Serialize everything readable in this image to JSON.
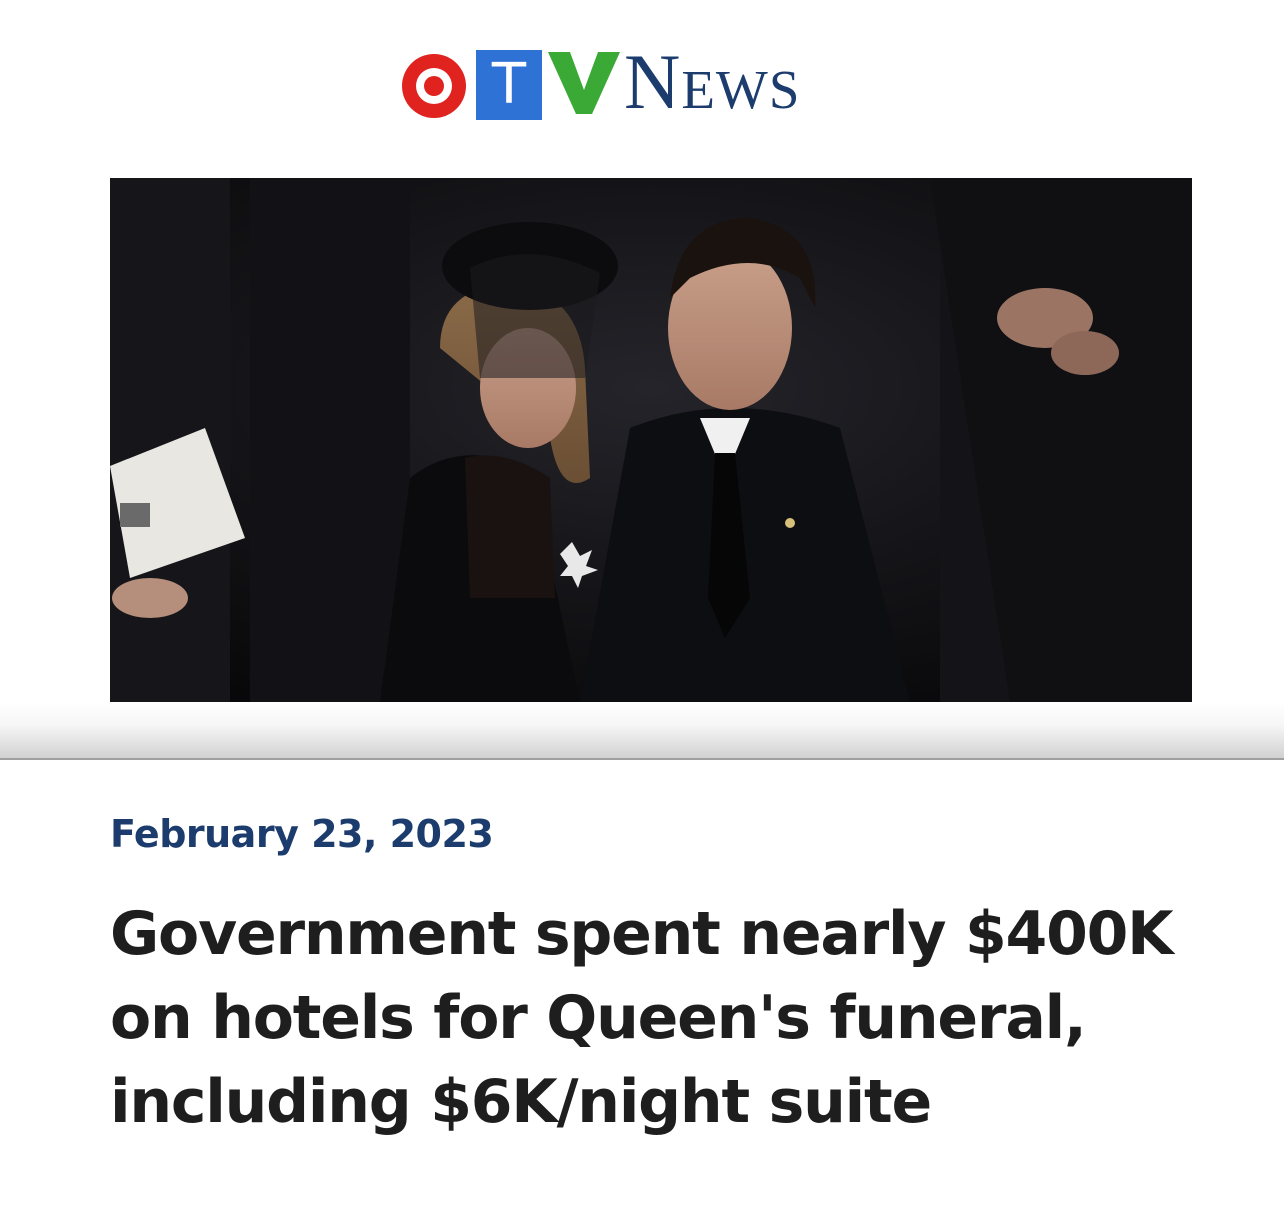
{
  "brand": {
    "logo_letters": [
      "C",
      "T",
      "V"
    ],
    "logo_word": "News",
    "colors": {
      "red": "#e0231f",
      "blue": "#2f72d6",
      "green": "#3aa935",
      "navy": "#1c3c6d"
    }
  },
  "article": {
    "date": "February 23, 2023",
    "headline": "Government spent nearly $400K on hotels for Queen's funeral, including $6K/night suite"
  }
}
